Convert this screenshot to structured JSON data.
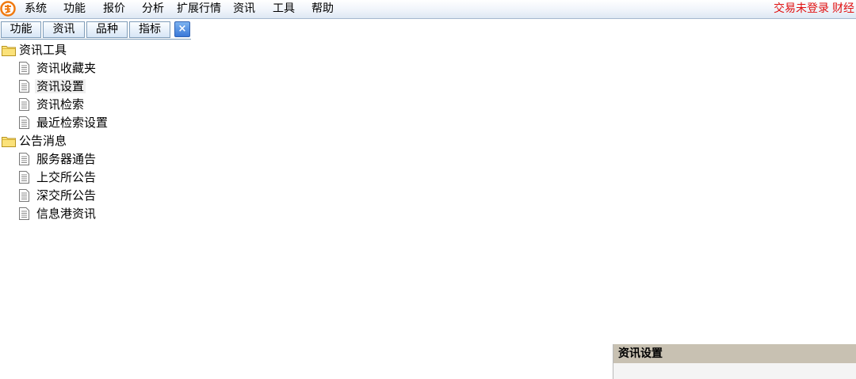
{
  "menubar": {
    "logo_icon": "app-logo-icon",
    "items": [
      "系统",
      "功能",
      "报价",
      "分析",
      "扩展行情",
      "资讯",
      "工具",
      "帮助"
    ],
    "status_text": "交易未登录",
    "finance_text": "财经"
  },
  "panel": {
    "tabs": [
      "功能",
      "资讯",
      "品种",
      "指标"
    ],
    "close_label": "×"
  },
  "tree": {
    "groups": [
      {
        "label": "资讯工具",
        "icon": "folder-icon",
        "items": [
          "资讯收藏夹",
          "资讯设置",
          "资讯检索",
          "最近检索设置"
        ]
      },
      {
        "label": "公告消息",
        "icon": "folder-icon",
        "items": [
          "服务器通告",
          "上交所公告",
          "深交所公告",
          "信息港资讯"
        ]
      }
    ],
    "selected_item": "资讯设置"
  },
  "popup": {
    "title": "资讯设置"
  },
  "colors": {
    "status_red": "#e01010",
    "menubar_bg": "#e6eef8",
    "popup_title_bg": "#c8c1b2"
  }
}
